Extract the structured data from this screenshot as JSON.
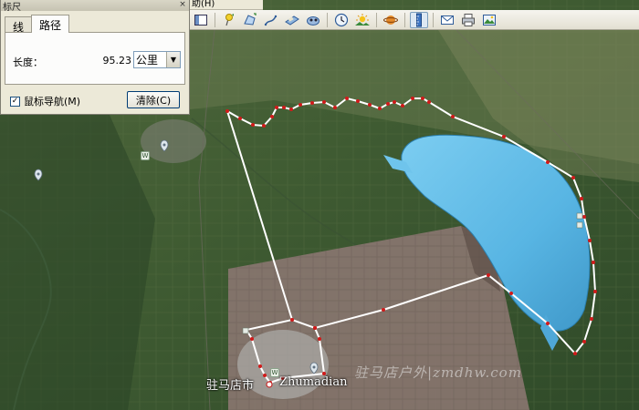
{
  "menu": {
    "help_label": "助(H)"
  },
  "ruler": {
    "title": "标尺",
    "close_glyph": "×",
    "tabs": [
      {
        "label": "线",
        "selected": false
      },
      {
        "label": "路径",
        "selected": true
      }
    ],
    "length_label": "长度：",
    "length_value": "95.23",
    "unit_selected": "公里",
    "mouse_nav_label": "鼠标导航(M)",
    "mouse_nav_checked": true,
    "check_glyph": "✓",
    "clear_label": "清除(C)"
  },
  "toolbar": {
    "buttons": [
      {
        "icon": "sidebar-icon",
        "active": false
      },
      {
        "icon": "placemark-icon",
        "active": false
      },
      {
        "icon": "polygon-icon",
        "active": false
      },
      {
        "icon": "path-icon",
        "active": false
      },
      {
        "icon": "overlay-icon",
        "active": false
      },
      {
        "icon": "record-tour-icon",
        "active": false
      },
      {
        "icon": "historical-imagery-icon",
        "active": false
      },
      {
        "icon": "sunlight-icon",
        "active": false
      },
      {
        "icon": "planets-icon",
        "active": false
      },
      {
        "icon": "ruler-icon",
        "active": true
      },
      {
        "icon": "email-icon",
        "active": false
      },
      {
        "icon": "print-icon",
        "active": false
      },
      {
        "icon": "save-image-icon",
        "active": false
      }
    ]
  },
  "map": {
    "city_label": "驻马店市",
    "city_label_en": "Zhumadian",
    "watermark": "驻马店户外|zmdhw.com",
    "water_color": "#5bb8e6",
    "path_color": "#ffffff",
    "vertex_color": "#d11a1a",
    "place_marker_glyph": "W"
  }
}
